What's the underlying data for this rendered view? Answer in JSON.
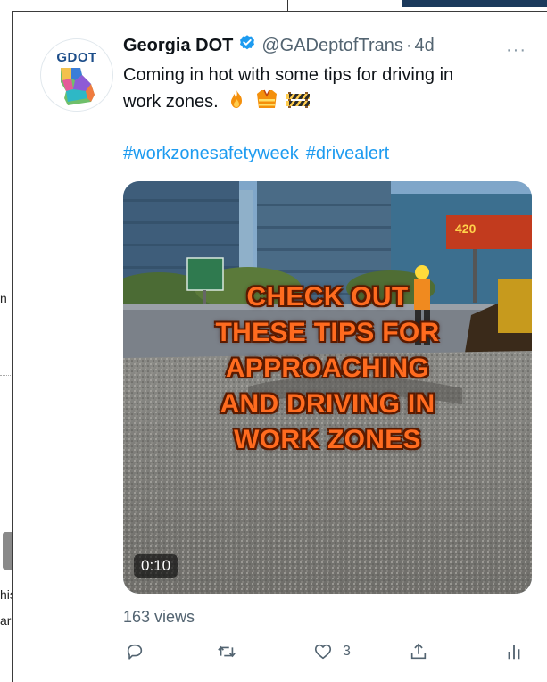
{
  "background": {
    "fragment_n": "n",
    "fragment_his": "his",
    "fragment_ar": "ar"
  },
  "tweet": {
    "avatar_label": "GDOT",
    "display_name": "Georgia DOT",
    "handle": "@GADeptofTrans",
    "separator": "·",
    "age": "4d",
    "text_line1": "Coming in hot with some tips for driving in",
    "text_line2": "work zones.",
    "emojis": [
      "fire-icon",
      "safety-vest-icon",
      "construction-barrier-icon"
    ],
    "hashtags": [
      "#workzonesafetyweek",
      "#drivealert"
    ],
    "video": {
      "overlay_lines": [
        "CHECK OUT",
        "THESE TIPS FOR",
        "APPROACHING",
        "AND DRIVING IN",
        "WORK ZONES"
      ],
      "duration": "0:10",
      "billboard_text": "420"
    },
    "views": "163 views",
    "actions": {
      "reply_icon": "reply-icon",
      "retweet_icon": "retweet-icon",
      "like_icon": "heart-icon",
      "like_count": "3",
      "share_icon": "share-icon",
      "analytics_icon": "analytics-icon"
    }
  },
  "colors": {
    "link_blue": "#1d9bf0",
    "muted_grey": "#536471",
    "overlay_orange": "#ff6b1f"
  }
}
